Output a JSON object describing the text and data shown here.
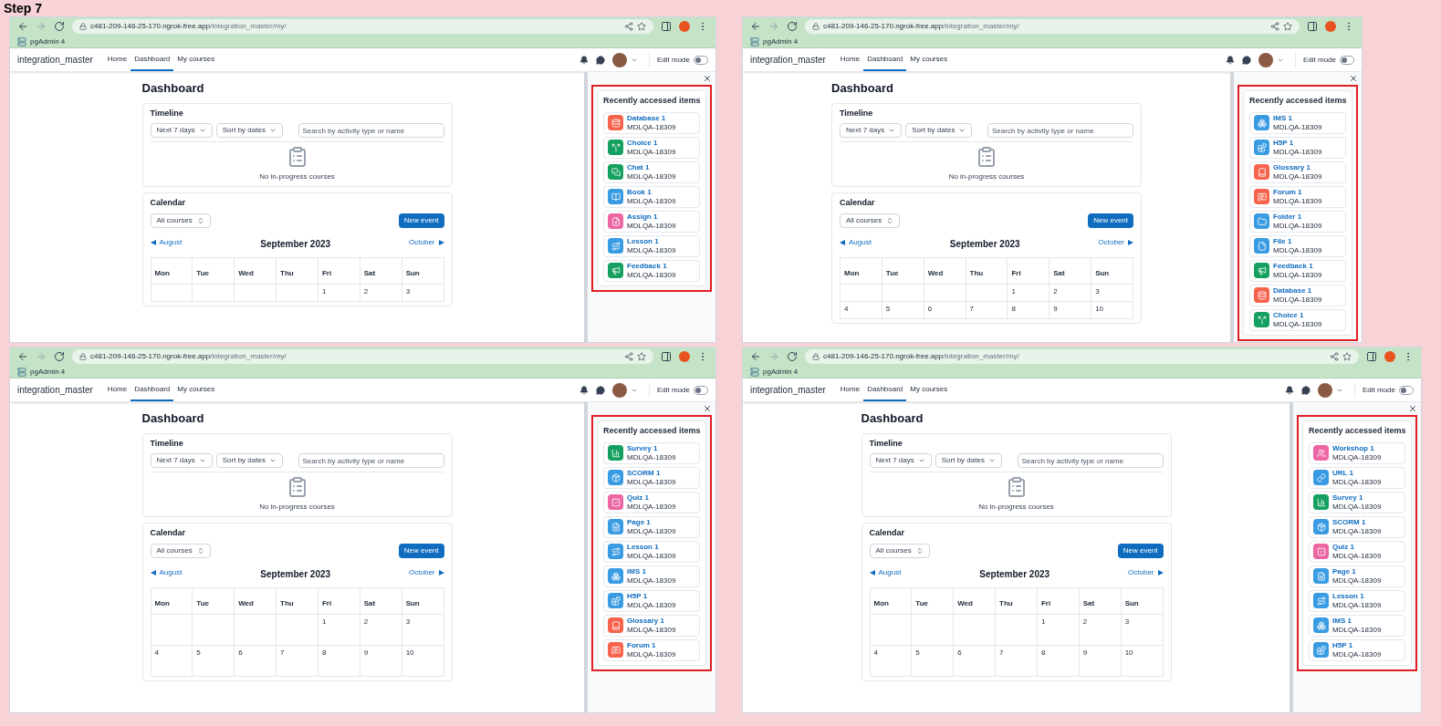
{
  "title": "Step 7",
  "panels": [
    {
      "url_host": "c481-209-146-25-170.ngrok-free.app",
      "url_path": "/integration_master/my/",
      "bookmark": "pgAdmin 4",
      "site_name": "integration_master",
      "nav": [
        {
          "label": "Home",
          "selected": false
        },
        {
          "label": "Dashboard",
          "selected": true
        },
        {
          "label": "My courses",
          "selected": false
        }
      ],
      "edit_mode": {
        "label": "Edit mode",
        "on": false
      },
      "dashboard": {
        "title": "Dashboard",
        "timeline": {
          "title": "Timeline",
          "filters": [
            "Next 7 days",
            "Sort by dates"
          ],
          "search_placeholder": "Search by activity type or name",
          "empty_text": "No in-progress courses"
        },
        "calendar": {
          "title": "Calendar",
          "course_select": "All courses",
          "new_event": "New event",
          "prev": "August",
          "month": "September 2023",
          "next": "October",
          "weekdays": [
            "Mon",
            "Tue",
            "Wed",
            "Thu",
            "Fri",
            "Sat",
            "Sun"
          ],
          "weeks": [
            [
              "1",
              "2",
              "3"
            ]
          ]
        }
      },
      "drawer": {
        "title": "Recently accessed items",
        "items": [
          {
            "kind": "database",
            "name": "Database 1",
            "code": "MDLQA-18309",
            "color": "#f7634d"
          },
          {
            "kind": "choice",
            "name": "Choice 1",
            "code": "MDLQA-18309",
            "color": "#15a05f"
          },
          {
            "kind": "chat",
            "name": "Chat 1",
            "code": "MDLQA-18309",
            "color": "#15a05f"
          },
          {
            "kind": "book",
            "name": "Book 1",
            "code": "MDLQA-18309",
            "color": "#399be2"
          },
          {
            "kind": "assign",
            "name": "Assign 1",
            "code": "MDLQA-18309",
            "color": "#eb66a2"
          },
          {
            "kind": "lesson",
            "name": "Lesson 1",
            "code": "MDLQA-18309",
            "color": "#399be2"
          },
          {
            "kind": "feedback",
            "name": "Feedback 1",
            "code": "MDLQA-18309",
            "color": "#15a05f"
          }
        ]
      }
    },
    {
      "url_host": "c481-209-146-25-170.ngrok-free.app",
      "url_path": "/integration_master/my/",
      "bookmark": "pgAdmin 4",
      "site_name": "integration_master",
      "nav": [
        {
          "label": "Home",
          "selected": false
        },
        {
          "label": "Dashboard",
          "selected": true
        },
        {
          "label": "My courses",
          "selected": false
        }
      ],
      "edit_mode": {
        "label": "Edit mode",
        "on": false
      },
      "dashboard": {
        "title": "Dashboard",
        "timeline": {
          "title": "Timeline",
          "filters": [
            "Next 7 days",
            "Sort by dates"
          ],
          "search_placeholder": "Search by activity type or name",
          "empty_text": "No in-progress courses"
        },
        "calendar": {
          "title": "Calendar",
          "course_select": "All courses",
          "new_event": "New event",
          "prev": "August",
          "month": "September 2023",
          "next": "October",
          "weekdays": [
            "Mon",
            "Tue",
            "Wed",
            "Thu",
            "Fri",
            "Sat",
            "Sun"
          ],
          "weeks": [
            [
              "1",
              "2",
              "3"
            ],
            [
              "4",
              "5",
              "6",
              "7",
              "8",
              "9",
              "10"
            ]
          ]
        }
      },
      "drawer": {
        "title": "Recently accessed items",
        "items": [
          {
            "kind": "ims",
            "name": "IMS 1",
            "code": "MDLQA-18309",
            "color": "#399be2"
          },
          {
            "kind": "h5p",
            "name": "H5P 1",
            "code": "MDLQA-18309",
            "color": "#399be2"
          },
          {
            "kind": "glossary",
            "name": "Glossary 1",
            "code": "MDLQA-18309",
            "color": "#f7634d"
          },
          {
            "kind": "forum",
            "name": "Forum 1",
            "code": "MDLQA-18309",
            "color": "#f7634d"
          },
          {
            "kind": "folder",
            "name": "Folder 1",
            "code": "MDLQA-18309",
            "color": "#399be2"
          },
          {
            "kind": "file",
            "name": "File 1",
            "code": "MDLQA-18309",
            "color": "#399be2"
          },
          {
            "kind": "feedback",
            "name": "Feedback 1",
            "code": "MDLQA-18309",
            "color": "#15a05f"
          },
          {
            "kind": "database",
            "name": "Database 1",
            "code": "MDLQA-18309",
            "color": "#f7634d"
          },
          {
            "kind": "choice",
            "name": "Choice 1",
            "code": "MDLQA-18309",
            "color": "#15a05f"
          }
        ]
      }
    },
    {
      "url_host": "c481-209-146-25-170.ngrok-free.app",
      "url_path": "/integration_master/my/",
      "bookmark": "pgAdmin 4",
      "site_name": "integration_master",
      "nav": [
        {
          "label": "Home",
          "selected": false
        },
        {
          "label": "Dashboard",
          "selected": true
        },
        {
          "label": "My courses",
          "selected": false
        }
      ],
      "edit_mode": {
        "label": "Edit mode",
        "on": false
      },
      "dashboard": {
        "title": "Dashboard",
        "timeline": {
          "title": "Timeline",
          "filters": [
            "Next 7 days",
            "Sort by dates"
          ],
          "search_placeholder": "Search by activity type or name",
          "empty_text": "No in-progress courses"
        },
        "calendar": {
          "title": "Calendar",
          "course_select": "All courses",
          "new_event": "New event",
          "prev": "August",
          "month": "September 2023",
          "next": "October",
          "weekdays": [
            "Mon",
            "Tue",
            "Wed",
            "Thu",
            "Fri",
            "Sat",
            "Sun"
          ],
          "weeks": [
            [
              "1",
              "2",
              "3"
            ],
            [
              "4",
              "5",
              "6",
              "7",
              "8",
              "9",
              "10"
            ]
          ]
        }
      },
      "drawer": {
        "title": "Recently accessed items",
        "items": [
          {
            "kind": "survey",
            "name": "Survey 1",
            "code": "MDLQA-18309",
            "color": "#15a05f"
          },
          {
            "kind": "scorm",
            "name": "SCORM 1",
            "code": "MDLQA-18309",
            "color": "#399be2"
          },
          {
            "kind": "quiz",
            "name": "Quiz 1",
            "code": "MDLQA-18309",
            "color": "#eb66a2"
          },
          {
            "kind": "page",
            "name": "Page 1",
            "code": "MDLQA-18309",
            "color": "#399be2"
          },
          {
            "kind": "lesson",
            "name": "Lesson 1",
            "code": "MDLQA-18309",
            "color": "#399be2"
          },
          {
            "kind": "ims",
            "name": "IMS 1",
            "code": "MDLQA-18309",
            "color": "#399be2"
          },
          {
            "kind": "h5p",
            "name": "H5P 1",
            "code": "MDLQA-18309",
            "color": "#399be2"
          },
          {
            "kind": "glossary",
            "name": "Glossary 1",
            "code": "MDLQA-18309",
            "color": "#f7634d"
          },
          {
            "kind": "forum",
            "name": "Forum 1",
            "code": "MDLQA-18309",
            "color": "#f7634d"
          }
        ]
      }
    },
    {
      "url_host": "c481-209-146-25-170.ngrok-free.app",
      "url_path": "/integration_master/my/",
      "bookmark": "pgAdmin 4",
      "site_name": "integration_master",
      "nav": [
        {
          "label": "Home",
          "selected": false
        },
        {
          "label": "Dashboard",
          "selected": true
        },
        {
          "label": "My courses",
          "selected": false
        }
      ],
      "edit_mode": {
        "label": "Edit mode",
        "on": false
      },
      "dashboard": {
        "title": "Dashboard",
        "timeline": {
          "title": "Timeline",
          "filters": [
            "Next 7 days",
            "Sort by dates"
          ],
          "search_placeholder": "Search by activity type or name",
          "empty_text": "No in-progress courses"
        },
        "calendar": {
          "title": "Calendar",
          "course_select": "All courses",
          "new_event": "New event",
          "prev": "August",
          "month": "September 2023",
          "next": "October",
          "weekdays": [
            "Mon",
            "Tue",
            "Wed",
            "Thu",
            "Fri",
            "Sat",
            "Sun"
          ],
          "weeks": [
            [
              "1",
              "2",
              "3"
            ],
            [
              "4",
              "5",
              "6",
              "7",
              "8",
              "9",
              "10"
            ]
          ]
        }
      },
      "drawer": {
        "title": "Recently accessed items",
        "items": [
          {
            "kind": "workshop",
            "name": "Workshop 1",
            "code": "MDLQA-18309",
            "color": "#eb66a2"
          },
          {
            "kind": "url",
            "name": "URL 1",
            "code": "MDLQA-18309",
            "color": "#399be2"
          },
          {
            "kind": "survey",
            "name": "Survey 1",
            "code": "MDLQA-18309",
            "color": "#15a05f"
          },
          {
            "kind": "scorm",
            "name": "SCORM 1",
            "code": "MDLQA-18309",
            "color": "#399be2"
          },
          {
            "kind": "quiz",
            "name": "Quiz 1",
            "code": "MDLQA-18309",
            "color": "#eb66a2"
          },
          {
            "kind": "page",
            "name": "Page 1",
            "code": "MDLQA-18309",
            "color": "#399be2"
          },
          {
            "kind": "lesson",
            "name": "Lesson 1",
            "code": "MDLQA-18309",
            "color": "#399be2"
          },
          {
            "kind": "ims",
            "name": "IMS 1",
            "code": "MDLQA-18309",
            "color": "#399be2"
          },
          {
            "kind": "h5p",
            "name": "H5P 1",
            "code": "MDLQA-18309",
            "color": "#399be2"
          }
        ]
      }
    }
  ]
}
